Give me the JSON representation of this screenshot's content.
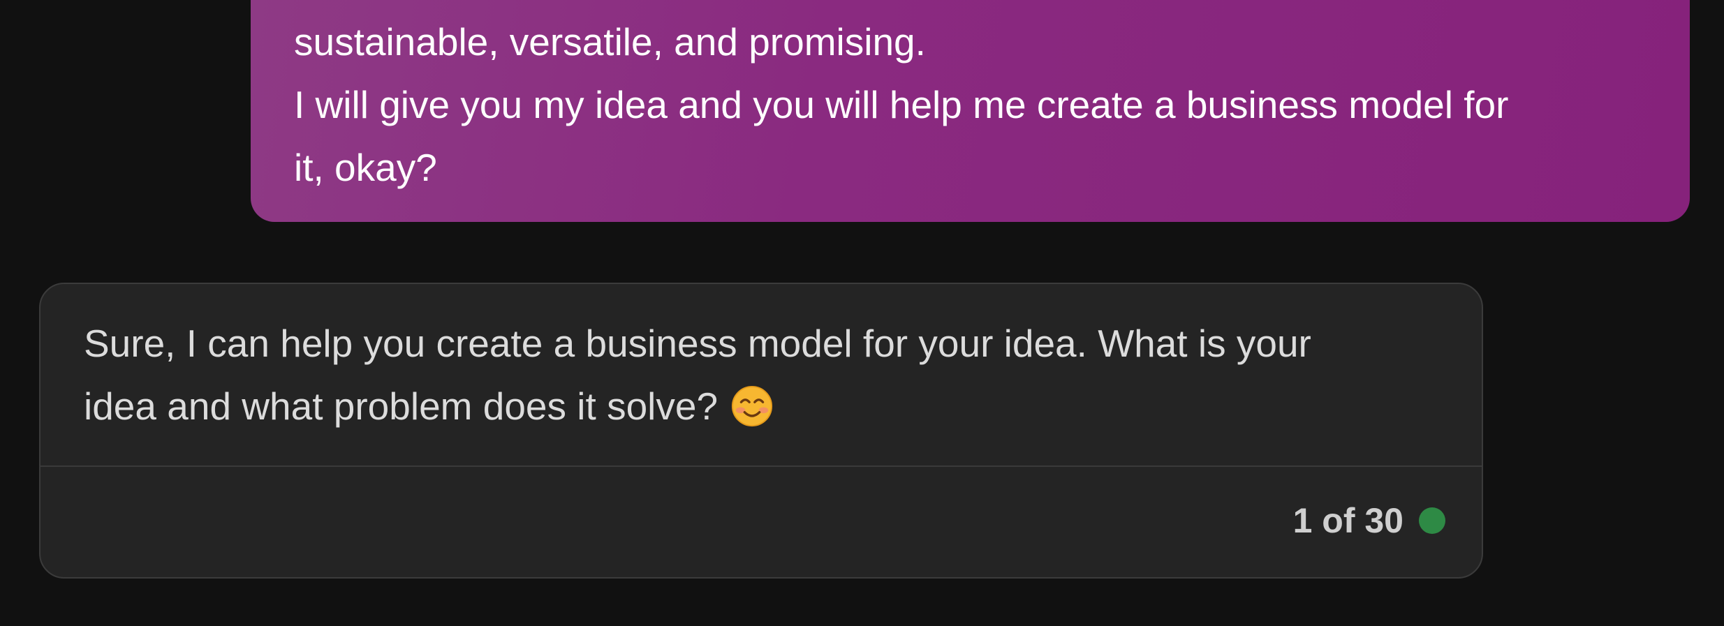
{
  "user_message": {
    "lines": [
      "sustainable, versatile, and promising.",
      "I will give you my idea and you will help me create a business model for",
      "it, okay?"
    ]
  },
  "assistant_message": {
    "lines": [
      "Sure, I can help you create a business model for your idea. What is your",
      "idea and what problem does it solve?"
    ],
    "emoji": "smiling-face-with-smiling-eyes-icon",
    "response_counter": "1 of 30",
    "status_color": "#2e8a45"
  },
  "colors": {
    "background": "#111111",
    "user_bubble": "#8a2a80",
    "assistant_card": "#242424"
  }
}
